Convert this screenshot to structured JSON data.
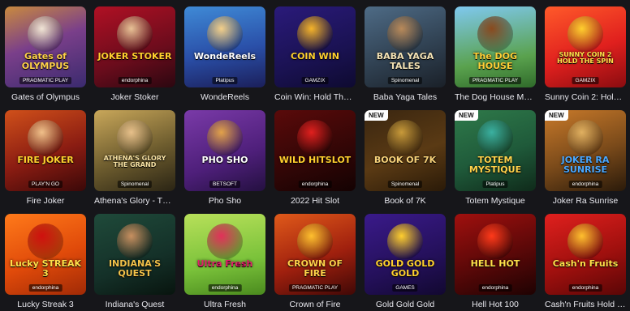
{
  "games": [
    {
      "title": "Gates of Olympus",
      "logo": "Gates of OLYMPUS",
      "provider": "PRAGMATIC PLAY",
      "bg": "linear-gradient(160deg,#c98a3e 0%,#7a3f8a 45%,#3a2a6e 100%)",
      "logo_color": "#ffd24a",
      "figure": "#f1e5d6",
      "new": false
    },
    {
      "title": "Joker Stoker",
      "logo": "JOKER STOKER",
      "provider": "endorphina",
      "bg": "linear-gradient(160deg,#b01024 0%,#6a0c1c 60%,#2b0710 100%)",
      "logo_color": "#ffcf2e",
      "figure": "#e8c296",
      "new": false
    },
    {
      "title": "WondeReels",
      "logo": "WondeReels",
      "provider": "Platipus",
      "bg": "linear-gradient(170deg,#3f8ad6 0%,#2a4fa8 55%,#1b1f5a 100%)",
      "logo_color": "#ffffff",
      "figure": "#f4d08a",
      "new": false
    },
    {
      "title": "Coin Win: Hold The Spin",
      "logo": "COIN WIN",
      "provider": "GAMZIX",
      "bg": "linear-gradient(160deg,#2a1a7a 0%,#1a1252 60%,#0e0a30 100%)",
      "logo_color": "#ffd12e",
      "figure": "#f5b42a",
      "new": false
    },
    {
      "title": "Baba Yaga Tales",
      "logo": "BABA YAGA TALES",
      "provider": "Spinomenal",
      "bg": "linear-gradient(160deg,#4e6b86 0%,#2e3e4e 60%,#1a2028 100%)",
      "logo_color": "#f3e2b4",
      "figure": "#b98a5a",
      "new": false
    },
    {
      "title": "The Dog House Mega…",
      "logo": "The DOG HOUSE",
      "provider": "PRAGMATIC PLAY",
      "bg": "linear-gradient(170deg,#7fc8ef 0%,#5aa24e 65%,#2f6a2a 100%)",
      "logo_color": "#ffcf36",
      "figure": "#8a4a1e",
      "new": false
    },
    {
      "title": "Sunny Coin 2: Hold T…",
      "logo": "SUNNY COIN 2 HOLD THE SPIN",
      "provider": "GAMZIX",
      "bg": "linear-gradient(160deg,#ff5a2a 0%,#e0201e 55%,#8a0c10 100%)",
      "logo_color": "#ffe04a",
      "figure": "#ffcf2e",
      "new": false
    },
    {
      "title": "Fire Joker",
      "logo": "FIRE JOKER",
      "provider": "PLAY'N GO",
      "bg": "linear-gradient(160deg,#d0501a 0%,#8a1c12 55%,#3a0808 100%)",
      "logo_color": "#ffd12e",
      "figure": "#f0c08a",
      "new": false
    },
    {
      "title": "Athena's Glory - The G…",
      "logo": "ATHENA'S GLORY THE GRAND",
      "provider": "Spinomenal",
      "bg": "linear-gradient(160deg,#c9a75a 0%,#6d5c2e 55%,#2a2414 100%)",
      "logo_color": "#f7e2a4",
      "figure": "#e7c08a",
      "new": false
    },
    {
      "title": "Pho Sho",
      "logo": "PHO SHO",
      "provider": "BETSOFT",
      "bg": "linear-gradient(160deg,#7a3aa8 0%,#4e1f7a 60%,#241040 100%)",
      "logo_color": "#ffffff",
      "figure": "#e2a24a",
      "new": false
    },
    {
      "title": "2022 Hit Slot",
      "logo": "WILD HITSLOT",
      "provider": "endorphina",
      "bg": "linear-gradient(160deg,#5a0a0a 0%,#300606 60%,#140202 100%)",
      "logo_color": "#ffcf2e",
      "figure": "#e0201e",
      "new": false
    },
    {
      "title": "Book of 7K",
      "logo": "BOOK OF 7K",
      "provider": "Spinomenal",
      "bg": "linear-gradient(160deg,#3a2610 0%,#5a3a14 55%,#2a1a08 100%)",
      "logo_color": "#f7d27a",
      "figure": "#c89a3a",
      "new": true
    },
    {
      "title": "Totem Mystique",
      "logo": "TOTEM MYSTIQUE",
      "provider": "Platipus",
      "bg": "linear-gradient(160deg,#2f7a4a 0%,#1f5a3a 55%,#0f2a1a 100%)",
      "logo_color": "#ffd24a",
      "figure": "#3ab0a0",
      "new": true
    },
    {
      "title": "Joker Ra Sunrise",
      "logo": "JOKER RA SUNRISE",
      "provider": "endorphina",
      "bg": "linear-gradient(160deg,#c97a2a 0%,#7a4a1a 55%,#2a1a0a 100%)",
      "logo_color": "#4aa8ff",
      "figure": "#e0b060",
      "new": true
    },
    {
      "title": "Lucky Streak 3",
      "logo": "Lucky STREAK 3",
      "provider": "endorphina",
      "bg": "linear-gradient(160deg,#ff7a1a 0%,#e04a0a 55%,#a02a06 100%)",
      "logo_color": "#ffe04a",
      "figure": "#d0100e",
      "new": false
    },
    {
      "title": "Indiana's Quest",
      "logo": "INDIANA'S QUEST",
      "provider": "",
      "bg": "linear-gradient(160deg,#1f4a3a 0%,#143028 60%,#08140e 100%)",
      "logo_color": "#f3c24a",
      "figure": "#c89060",
      "new": false
    },
    {
      "title": "Ultra Fresh",
      "logo": "Ultra Fresh",
      "provider": "endorphina",
      "bg": "linear-gradient(170deg,#b8e05a 0%,#7ac23a 60%,#4a8a1e 100%)",
      "logo_color": "#e0206a",
      "figure": "#e2305a",
      "new": false
    },
    {
      "title": "Crown of Fire",
      "logo": "CROWN OF FIRE",
      "provider": "PRAGMATIC PLAY",
      "bg": "linear-gradient(160deg,#e05a1a 0%,#a0200e 55%,#400806 100%)",
      "logo_color": "#ffd24a",
      "figure": "#ffc02e",
      "new": false
    },
    {
      "title": "Gold Gold Gold",
      "logo": "GOLD GOLD GOLD",
      "provider": "GAMES",
      "bg": "linear-gradient(160deg,#3a1a8a 0%,#24105a 60%,#120830 100%)",
      "logo_color": "#ffd12e",
      "figure": "#ffcf2e",
      "new": false
    },
    {
      "title": "Hell Hot 100",
      "logo": "HELL HOT",
      "provider": "endorphina",
      "bg": "linear-gradient(160deg,#a0100e 0%,#5a0808 55%,#1e0202 100%)",
      "logo_color": "#ffe04a",
      "figure": "#ff3a1a",
      "new": false
    },
    {
      "title": "Cash'n Fruits Hold and…",
      "logo": "Cash'n Fruits",
      "provider": "endorphina",
      "bg": "linear-gradient(160deg,#e0201e 0%,#a0100e 55%,#5a0606 100%)",
      "logo_color": "#ffe04a",
      "figure": "#ffc02e",
      "new": false
    }
  ],
  "badge_text": "NEW"
}
